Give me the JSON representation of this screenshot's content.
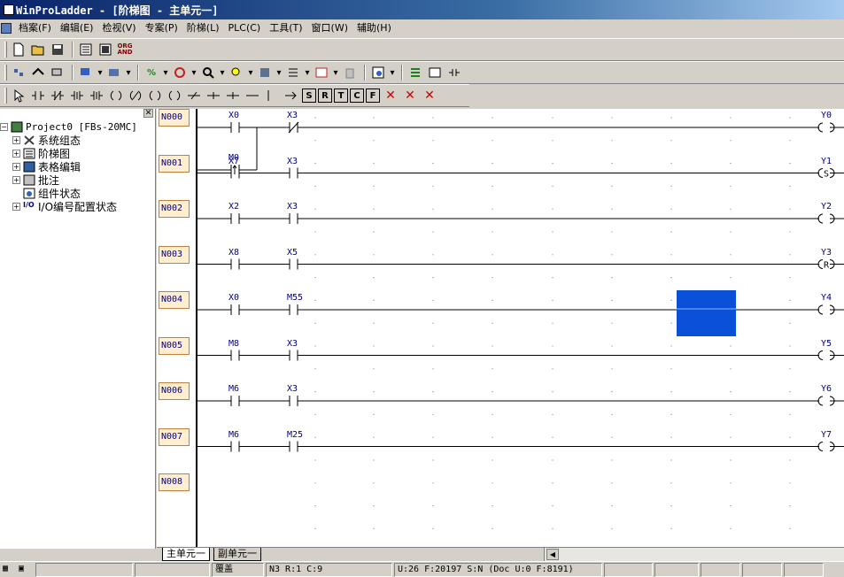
{
  "window": {
    "title": "WinProLadder - [阶梯图 - 主单元一]"
  },
  "menu": [
    "档案(F)",
    "编辑(E)",
    "检视(V)",
    "专案(P)",
    "阶梯(L)",
    "PLC(C)",
    "工具(T)",
    "窗口(W)",
    "辅助(H)"
  ],
  "toolbar3": {
    "s": "S",
    "r": "R",
    "t": "T",
    "c": "C",
    "f": "F",
    "org_and": "ORG AND"
  },
  "tree": {
    "root": "Project0 [FBs-20MC]",
    "items": [
      "系统组态",
      "阶梯图",
      "表格编辑",
      "批注",
      "组件状态",
      "I/O编号配置状态"
    ]
  },
  "ladder": {
    "networks": [
      {
        "id": "N000",
        "contacts": [
          {
            "name": "X0",
            "type": "NO"
          },
          {
            "name": "X3",
            "type": "NC"
          }
        ],
        "branch": {
          "name": "M0",
          "type": "P"
        },
        "coil": {
          "name": "Y0",
          "type": "( )"
        }
      },
      {
        "id": "N001",
        "contacts": [
          {
            "name": "X7",
            "type": "NO"
          },
          {
            "name": "X3",
            "type": "NO"
          }
        ],
        "coil": {
          "name": "Y1",
          "type": "(S)"
        }
      },
      {
        "id": "N002",
        "contacts": [
          {
            "name": "X2",
            "type": "NO"
          },
          {
            "name": "X3",
            "type": "NO"
          }
        ],
        "coil": {
          "name": "Y2",
          "type": "( )"
        }
      },
      {
        "id": "N003",
        "contacts": [
          {
            "name": "X8",
            "type": "NO"
          },
          {
            "name": "X5",
            "type": "NO"
          }
        ],
        "coil": {
          "name": "Y3",
          "type": "(R)"
        }
      },
      {
        "id": "N004",
        "contacts": [
          {
            "name": "X0",
            "type": "NO"
          },
          {
            "name": "M55",
            "type": "NO"
          }
        ],
        "coil": {
          "name": "Y4",
          "type": "( )"
        }
      },
      {
        "id": "N005",
        "contacts": [
          {
            "name": "M8",
            "type": "NO"
          },
          {
            "name": "X3",
            "type": "NO"
          }
        ],
        "coil": {
          "name": "Y5",
          "type": "( )"
        }
      },
      {
        "id": "N006",
        "contacts": [
          {
            "name": "M6",
            "type": "NO"
          },
          {
            "name": "X3",
            "type": "NO"
          }
        ],
        "coil": {
          "name": "Y6",
          "type": "( )"
        }
      },
      {
        "id": "N007",
        "contacts": [
          {
            "name": "M6",
            "type": "NO"
          },
          {
            "name": "M25",
            "type": "NO"
          }
        ],
        "coil": {
          "name": "Y7",
          "type": "( )"
        }
      },
      {
        "id": "N008",
        "contacts": [],
        "coil": null
      }
    ]
  },
  "sheets": [
    "主单元一",
    "副单元一"
  ],
  "status": {
    "mode": "覆盖",
    "position": "N3 R:1 C:9",
    "memory": "U:26 F:20197 S:N (Doc U:0 F:8191)"
  },
  "colors": {
    "selection": "#0a50d8",
    "label_color": "#000080",
    "network_label_bg": "#ffeed0"
  }
}
